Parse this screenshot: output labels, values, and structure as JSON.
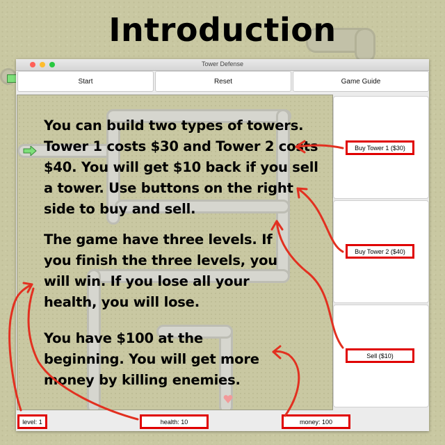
{
  "heading": "Introduction",
  "window": {
    "title": "Tower Defense",
    "traffic_lights": [
      "#ff5f57",
      "#febc2e",
      "#28c840"
    ]
  },
  "toolbar": {
    "start_label": "Start",
    "reset_label": "Reset",
    "guide_label": "Game Guide"
  },
  "guide": {
    "paragraph1": "You can build two types of towers. Tower 1 costs $30 and Tower 2 costs $40. You will get $10 back if you sell a tower. Use buttons on the right side to buy and sell.",
    "paragraph2": "The game have three levels. If you finish the three levels, you will win. If you lose all your health, you will lose.",
    "paragraph3": "You have $100 at the beginning. You will get more money by killing enemies."
  },
  "shop": {
    "buy_tower1_label": "Buy Tower 1 ($30)",
    "buy_tower2_label": "Buy Tower 2 ($40)",
    "sell_label": "Sell ($10)"
  },
  "status": {
    "level_label": "level: 1",
    "health_label": "health: 10",
    "money_label": "money: 100"
  },
  "colors": {
    "annotation": "#e00000",
    "entry_arrow": "#7ee07a",
    "grass": "#c9c8a2"
  }
}
